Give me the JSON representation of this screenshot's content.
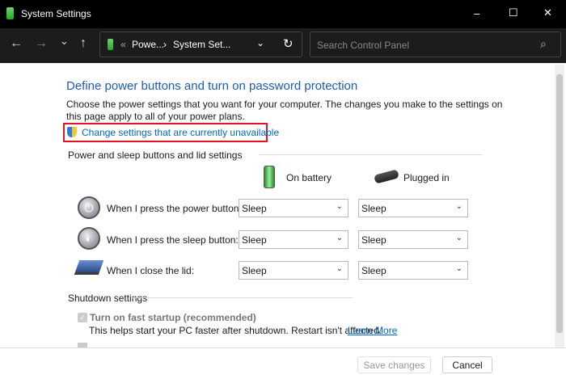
{
  "window": {
    "title": "System Settings",
    "minimize": "–",
    "maximize": "☐",
    "close": "✕"
  },
  "toolbar": {
    "back": "←",
    "forward": "→",
    "recent": "⌄",
    "up": "↑",
    "breadcrumb_overflow": "«",
    "crumb1": "Powe...",
    "sep": "›",
    "crumb2": "System Set...",
    "dropdown": "⌄",
    "refresh": "↻",
    "search_placeholder": "Search Control Panel",
    "search_icon": "⌕"
  },
  "main": {
    "heading": "Define power buttons and turn on password protection",
    "description": "Choose the power settings that you want for your computer. The changes you make to the settings on this page apply to all of your power plans.",
    "change_link": "Change settings that are currently unavailable",
    "section1": "Power and sleep buttons and lid settings",
    "col_battery": "On battery",
    "col_plugged": "Plugged in",
    "rows": [
      {
        "label": "When I press the power button:",
        "battery": "Sleep",
        "plugged": "Sleep"
      },
      {
        "label": "When I press the sleep button:",
        "battery": "Sleep",
        "plugged": "Sleep"
      },
      {
        "label": "When I close the lid:",
        "battery": "Sleep",
        "plugged": "Sleep"
      }
    ],
    "section2": "Shutdown settings",
    "fast_startup": {
      "label": "Turn on fast startup (recommended)",
      "checked": true,
      "desc": "This helps start your PC faster after shutdown. Restart isn't affected.",
      "learn_more": "Learn More"
    }
  },
  "footer": {
    "save": "Save changes",
    "cancel": "Cancel"
  },
  "colors": {
    "heading": "#1e5cb3",
    "link": "#0066cc",
    "highlight": "#e81123"
  }
}
